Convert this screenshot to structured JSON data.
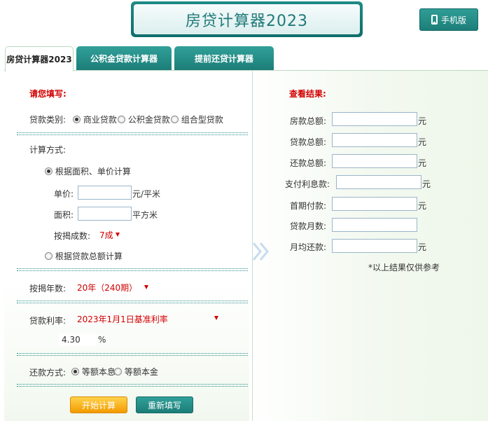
{
  "header": {
    "title": "房贷计算器2023",
    "mobile_label": "手机版"
  },
  "tabs": [
    "房贷计算器2023",
    "公积金贷款计算器",
    "提前还贷计算器"
  ],
  "form": {
    "heading": "请您填写:",
    "loan_type_label": "贷款类别:",
    "loan_types": [
      "商业贷款",
      "公积金贷款",
      "组合型贷款"
    ],
    "calc_method_label": "计算方式:",
    "method_area": "根据面积、单价计算",
    "unit_price_label": "单价:",
    "unit_price_unit": "元/平米",
    "area_label": "面积:",
    "area_unit": "平方米",
    "ratio_label": "按揭成数:",
    "ratio_value": "7成",
    "method_total": "根据贷款总额计算",
    "years_label": "按揭年数:",
    "years_value": "20年（240期）",
    "rate_label": "贷款利率:",
    "rate_value": "2023年1月1日基准利率",
    "rate_number": "4.30",
    "rate_unit": "%",
    "repay_label": "还款方式:",
    "repay_options": [
      "等额本息",
      "等额本金"
    ],
    "start_button": "开始计算",
    "reset_button": "重新填写"
  },
  "results": {
    "heading": "查看结果:",
    "rows": [
      {
        "label": "房款总额:",
        "unit": "元"
      },
      {
        "label": "贷款总额:",
        "unit": "元"
      },
      {
        "label": "还款总额:",
        "unit": "元"
      },
      {
        "label": "支付利息款:",
        "unit": "元"
      },
      {
        "label": "首期付款:",
        "unit": "元"
      },
      {
        "label": "贷款月数:",
        "unit": ""
      },
      {
        "label": "月均还款:",
        "unit": "元"
      }
    ],
    "note": "*以上结果仅供参考"
  },
  "colors": {
    "accent": "#1f7a78",
    "tab": "#2a958f",
    "warning": "#d20000",
    "start": "#f5a100"
  },
  "icons": {
    "mobile": "phone-icon",
    "arrow": "double-chevron-right-icon"
  }
}
